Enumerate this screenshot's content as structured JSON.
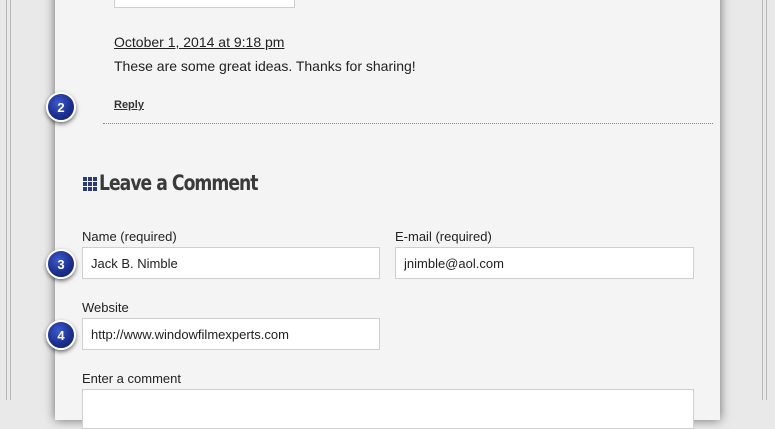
{
  "comment": {
    "date": "October 1, 2014 at 9:18 pm",
    "text": "These are some great ideas. Thanks for sharing!",
    "reply_label": "Reply"
  },
  "form": {
    "title": "Leave a Comment",
    "name_label": "Name (required)",
    "name_value": "Jack B. Nimble",
    "email_label": "E-mail (required)",
    "email_value": "jnimble@aol.com",
    "website_label": "Website",
    "website_value": "http://www.windowfilmexperts.com",
    "comment_label": "Enter a comment"
  },
  "markers": [
    "2",
    "3",
    "4"
  ],
  "colors": {
    "marker": "#1c2f8f",
    "title_icon": "#2b3a78",
    "panel": "#f4f4f4",
    "background": "#e9e9e9"
  },
  "icons": {
    "section_title": "grid-icon"
  }
}
